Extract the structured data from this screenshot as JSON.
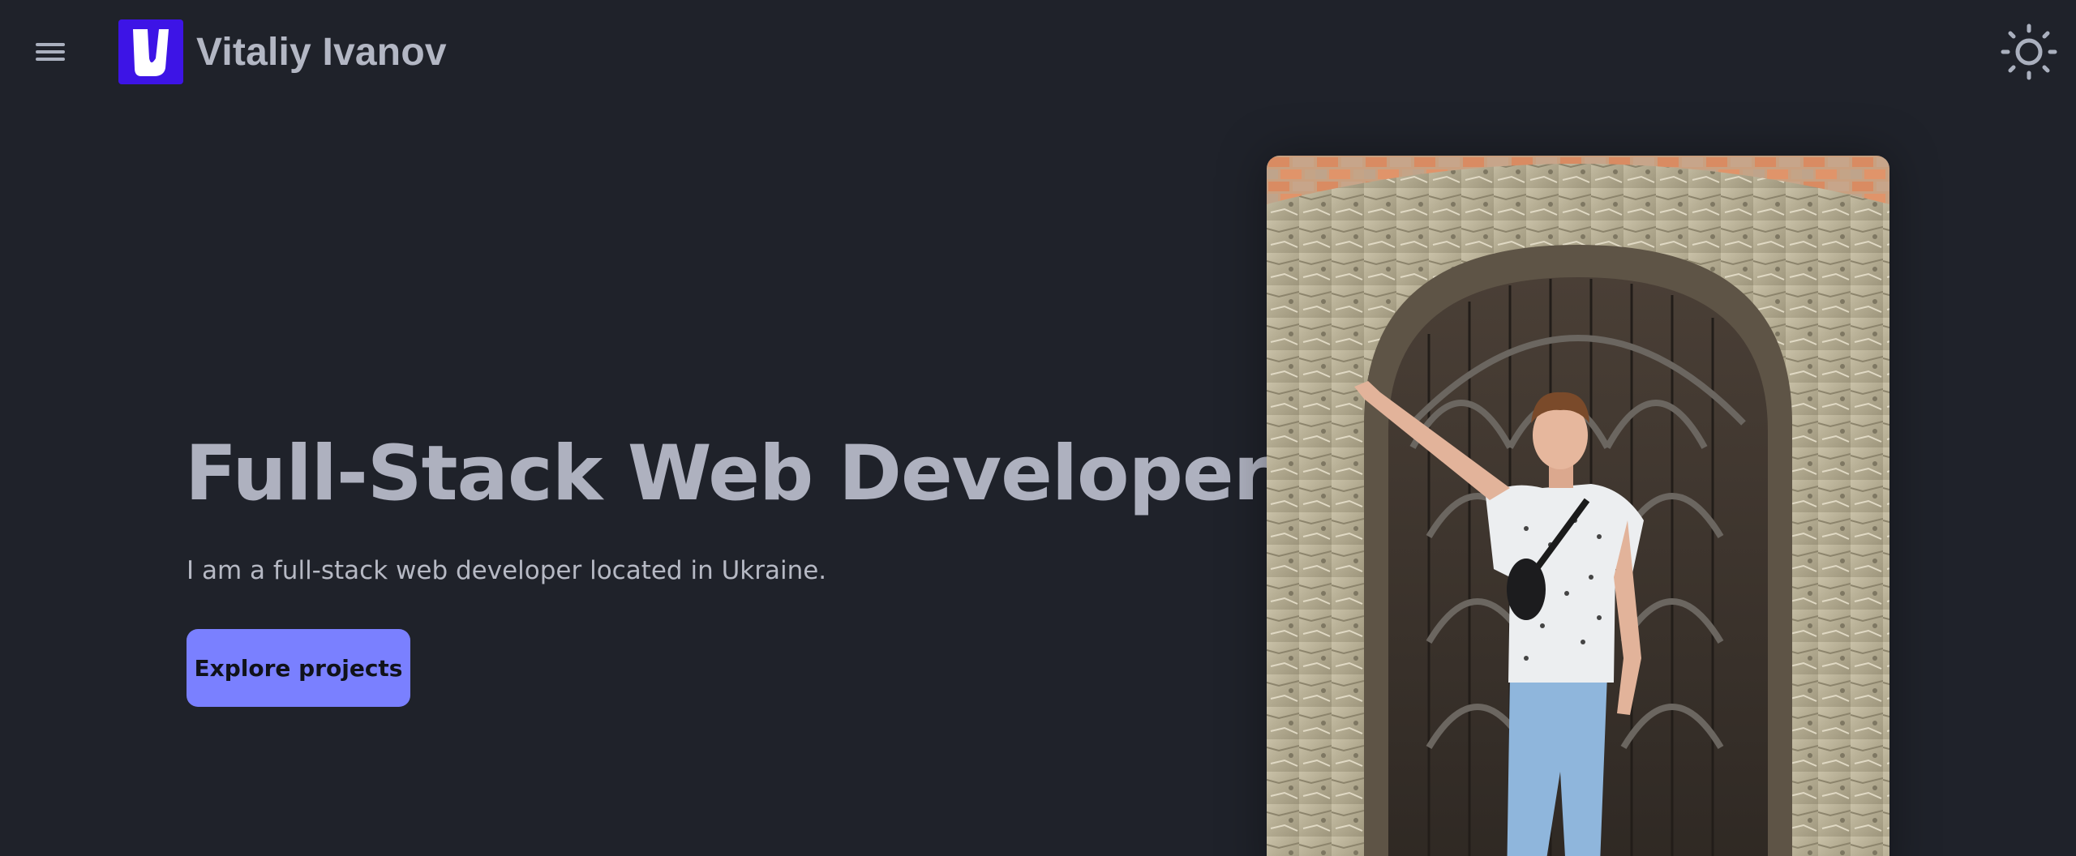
{
  "header": {
    "brand_name": "Vitaliy Ivanov",
    "logo_letter": "V",
    "logo_color": "#3d14e6",
    "menu_icon": "hamburger-menu-icon",
    "theme_icon": "sun-icon"
  },
  "hero": {
    "title": "Full-Stack Web Developer",
    "subtitle": "I am a full-stack web developer located in Ukraine.",
    "cta_label": "Explore projects",
    "cta_color": "#7a80ff"
  },
  "photo": {
    "subject": "person-leaning-at-arched-wooden-door"
  },
  "colors": {
    "background": "#1f222a",
    "text": "#aeb1bf"
  }
}
